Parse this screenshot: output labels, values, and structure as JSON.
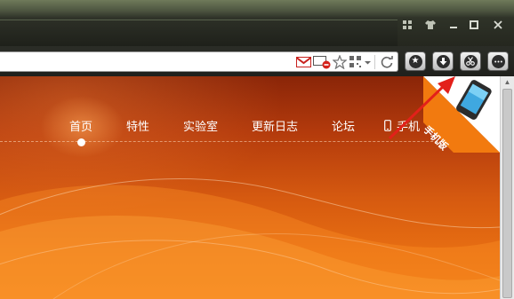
{
  "nav": {
    "items": [
      {
        "label": "首页"
      },
      {
        "label": "特性"
      },
      {
        "label": "实验室"
      },
      {
        "label": "更新日志"
      },
      {
        "label": "论坛"
      },
      {
        "label": "手机"
      }
    ]
  },
  "mobile_badge": {
    "label": "手机版"
  },
  "colors": {
    "page_top": "#8a2508",
    "page_bottom": "#ef7a14",
    "arrow": "#e3201a",
    "badge": "#f27a0f"
  },
  "icons": {
    "window_controls": [
      "skin-icon",
      "shirt-icon",
      "minimize-icon",
      "maximize-icon",
      "close-icon"
    ],
    "url_bar": [
      "gmail-icon",
      "screen-block-icon",
      "star-add-icon",
      "qr-code-icon",
      "chevron-down-icon",
      "refresh-icon"
    ],
    "toolbar": [
      "favorites-icon",
      "download-icon",
      "scissors-icon",
      "menu-icon"
    ]
  }
}
